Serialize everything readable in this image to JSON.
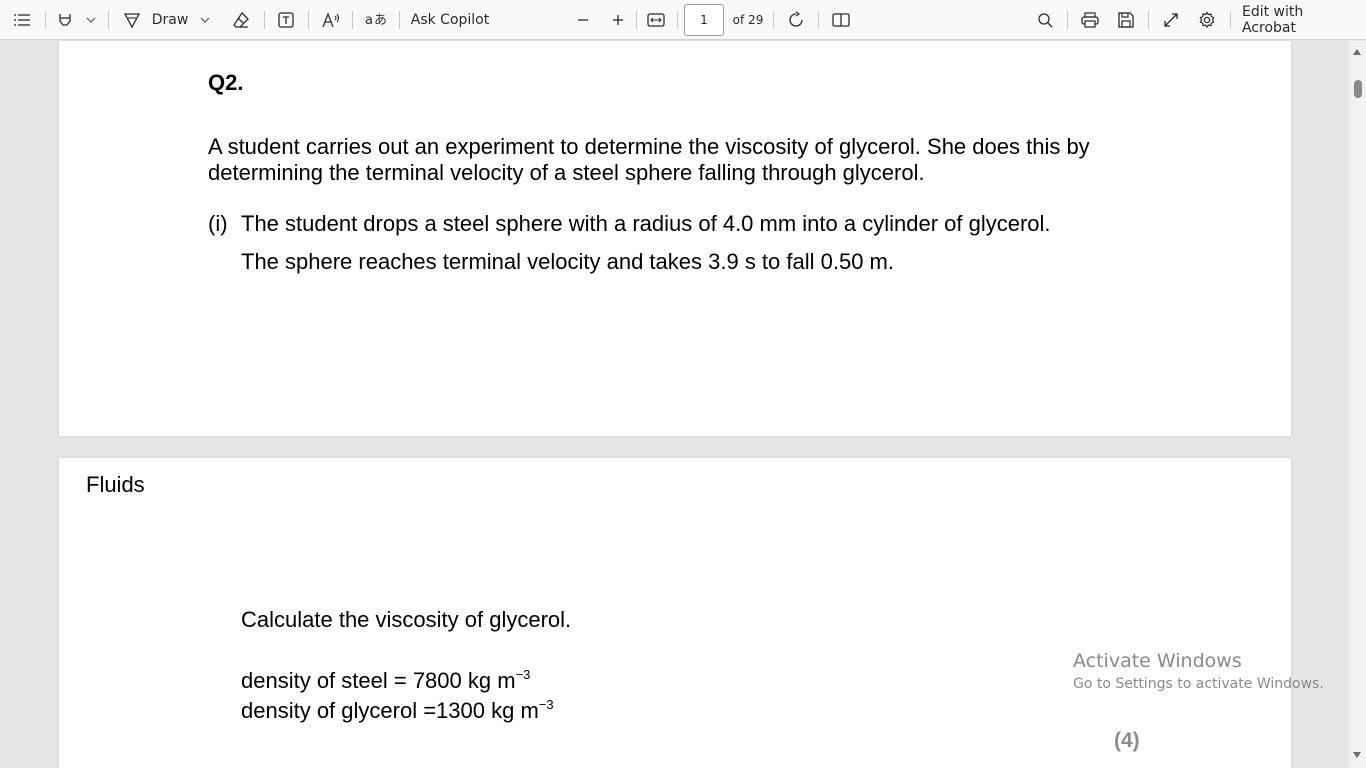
{
  "toolbar": {
    "draw_label": "Draw",
    "ask_copilot_label": "Ask Copilot",
    "page_number": "1",
    "page_total": "of 29",
    "edit_acrobat_label": "Edit with Acrobat",
    "icons": [
      "contents-icon",
      "highlight-icon",
      "draw-icon",
      "eraser-icon",
      "text-box-icon",
      "read-aloud-icon",
      "translate-icon",
      "zoom-out-icon",
      "zoom-in-icon",
      "fit-width-icon",
      "rotate-icon",
      "page-view-icon",
      "search-icon",
      "print-icon",
      "save-icon",
      "fullscreen-icon",
      "settings-icon"
    ]
  },
  "page1": {
    "question_title": "Q2.",
    "intro_line1": "A student carries out an experiment to determine the viscosity of glycerol. She does this by",
    "intro_line2": "determining the terminal velocity of a steel sphere falling through glycerol.",
    "part_label": "(i)",
    "part_line1": "The student drops a steel sphere with a radius of 4.0 mm into a cylinder of glycerol.",
    "part_line2": "The sphere reaches terminal velocity and takes 3.9 s to fall 0.50 m."
  },
  "page2": {
    "header": "Fluids",
    "instruction": "Calculate the viscosity of glycerol.",
    "density_steel": "density of steel = 7800 kg m",
    "density_glycerol": "density of glycerol =1300 kg m",
    "exponent": "−3",
    "marks": "(4)"
  },
  "watermark": {
    "line1": "Activate Windows",
    "line2": "Go to Settings to activate Windows."
  }
}
